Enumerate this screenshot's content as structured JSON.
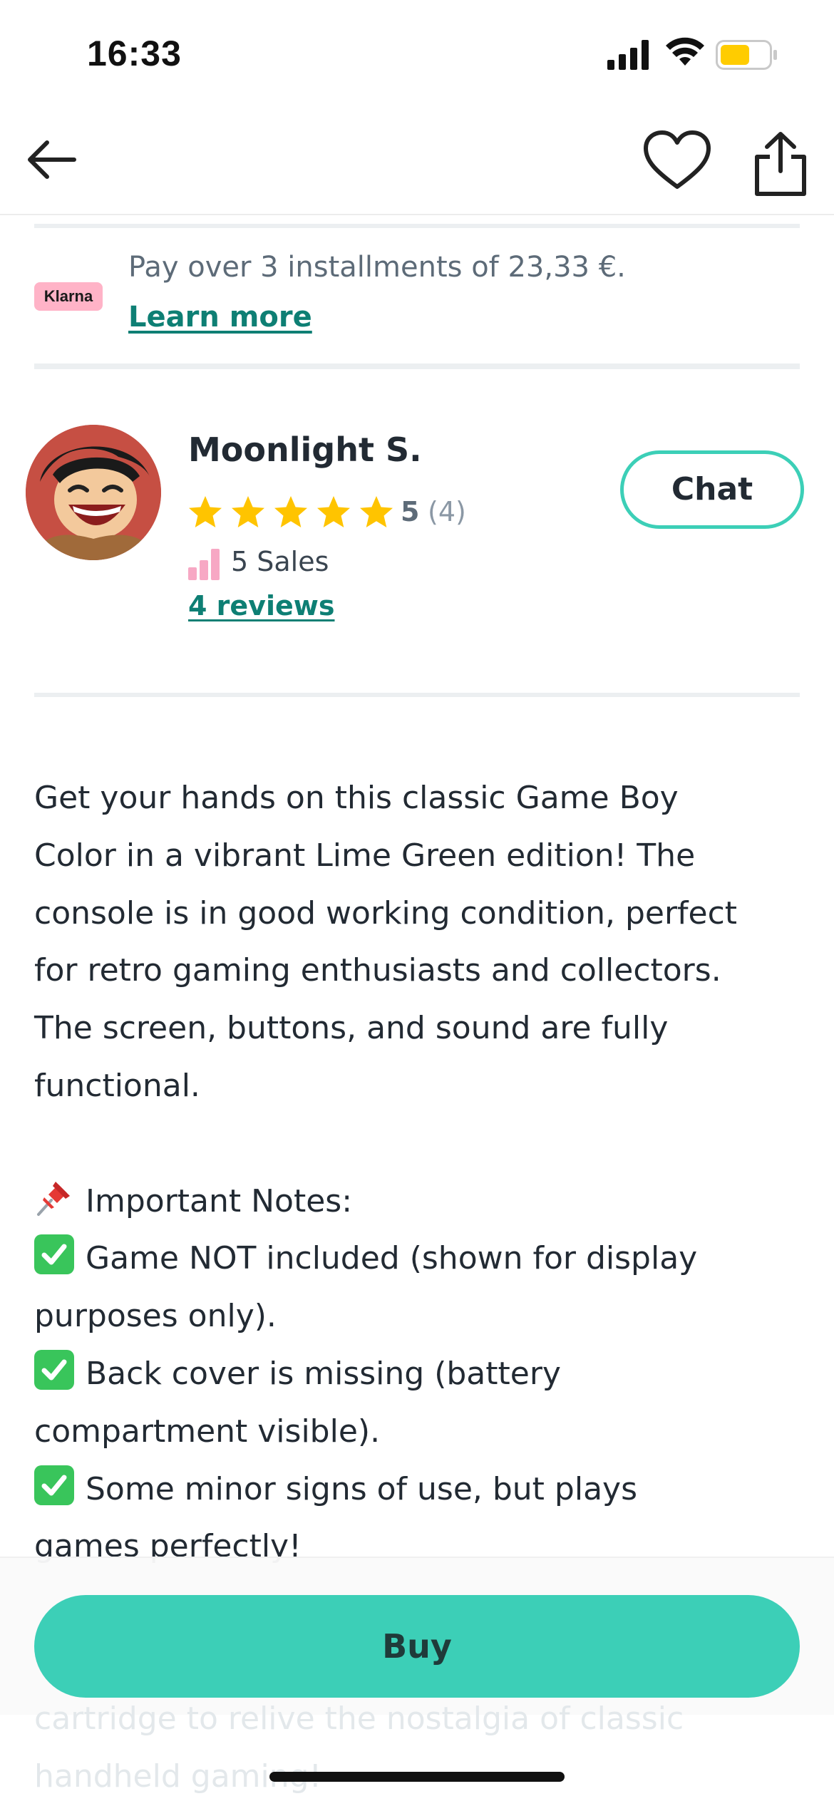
{
  "status_bar": {
    "time": "16:33"
  },
  "klarna": {
    "badge": "Klarna",
    "text": "Pay over 3 installments of 23,33 €.",
    "link": "Learn more"
  },
  "seller": {
    "name": "Moonlight S.",
    "rating": "5",
    "rating_count": "(4)",
    "stars": 5,
    "sales": "5 Sales",
    "reviews_link": "4 reviews",
    "chat_label": "Chat"
  },
  "description": {
    "lines": [
      "Get your hands on this classic Game Boy",
      "Color in a vibrant Lime Green edition! The",
      "console is in good working condition, perfect",
      "for retro gaming enthusiasts and collectors.",
      "The screen, buttons, and sound are fully",
      "functional."
    ],
    "notes_heading": "Important Notes:",
    "note1_a": "Game NOT included (shown for display",
    "note1_b": "purposes only).",
    "note2_a": "Back cover is missing (battery",
    "note2_b": "compartment visible).",
    "note3_a": "Some minor signs of use, but plays",
    "note3_b": "games perfectly!",
    "hidden_a": "cartridge to relive the nostalgia of classic",
    "hidden_b": "handheld gaming!"
  },
  "buy_label": "Buy",
  "colors": {
    "accent": "#3ccfb7",
    "link": "#0e7f74",
    "star": "#ffc400",
    "klarna_pink": "#ffb3c7"
  }
}
